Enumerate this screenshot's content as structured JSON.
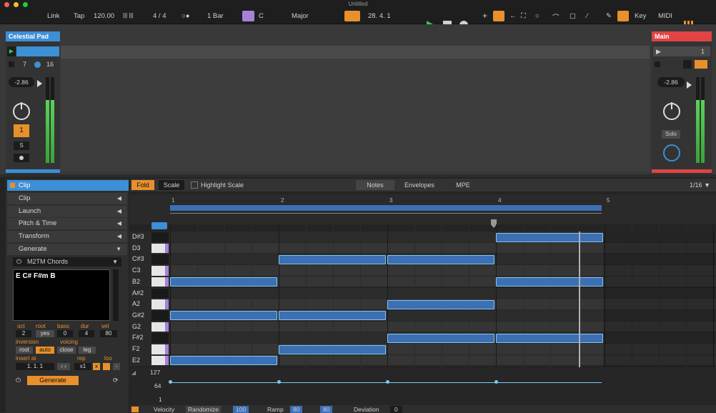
{
  "window": {
    "title": "Untitled"
  },
  "controlbar": {
    "link": "Link",
    "tap": "Tap",
    "tempo": "120.00",
    "tempo_sep": "|||  |||",
    "signature": "4 / 4",
    "metro": "○●",
    "quantize": "1 Bar",
    "key_root": "C",
    "scale_mode": "Major",
    "position": "28.  4.  1",
    "key_label": "Key",
    "midi_label": "MIDI"
  },
  "tracks": {
    "left": {
      "name": "Celestial Pad",
      "num": "7",
      "num2": "16",
      "volume": "-2.86",
      "arm": "1",
      "solo": "S"
    },
    "right": {
      "name": "Main",
      "num": "1",
      "volume": "-2.86",
      "solo": "Solo"
    }
  },
  "inspector": {
    "clip_header": "Clip",
    "sections": [
      "Clip",
      "Launch",
      "Pitch & Time",
      "Transform",
      "Generate"
    ],
    "device": "M2TM Chords",
    "chord_text": "E C# F#m B",
    "params_labels": [
      "oct",
      "root",
      "bass",
      "dur",
      "vel"
    ],
    "params_values": [
      "2",
      "yes",
      "0",
      "4",
      "80"
    ],
    "inversion_label": "inversion",
    "voicing_label": "voicing",
    "voicing_opts": [
      "root",
      "auto",
      "close",
      "leg"
    ],
    "insert_label": "insert at",
    "rep_label": "rep",
    "loo_label": "loo",
    "insert_value": "1.  1.  1",
    "rep_value": "x1",
    "generate_btn": "Generate"
  },
  "editor": {
    "fold": "Fold",
    "scale": "Scale",
    "highlight": "Highlight Scale",
    "tabs": [
      "Notes",
      "Envelopes",
      "MPE"
    ],
    "grid": "1/16",
    "ruler": [
      "1",
      "2",
      "3",
      "4",
      "5"
    ],
    "keys": [
      "D#3",
      "D3",
      "C#3",
      "C3",
      "B2",
      "A#2",
      "A2",
      "G#2",
      "G2",
      "F#2",
      "F2",
      "E2"
    ],
    "velocity_ticks": [
      "127",
      "64",
      "1"
    ]
  },
  "bottombar": {
    "velocity": "Velocity",
    "randomize": "Randomize",
    "vel_val": "100",
    "ramp": "Ramp",
    "ramp_v1": "80",
    "ramp_v2": "80",
    "deviation": "Deviation",
    "dev_val": "0"
  },
  "colors": {
    "accent": "#e8902c",
    "clip": "#3d6fb4",
    "note_border": "#7cc8f0",
    "track_left": "#3d8fd6",
    "track_right": "#e04444"
  }
}
